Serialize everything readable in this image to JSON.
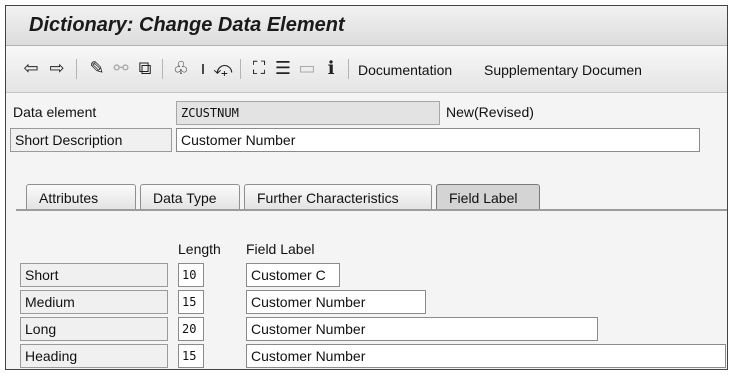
{
  "window": {
    "title": "Dictionary: Change Data Element"
  },
  "toolbar": {
    "icons": [
      "back-arrow-icon",
      "forward-arrow-icon",
      "display-change-icon",
      "activate-icon",
      "check-icon",
      "hierarchy-icon",
      "where-used-icon",
      "navigate-icon",
      "object-list-icon",
      "stack-icon",
      "display-object-icon",
      "information-icon"
    ],
    "documentation_label": "Documentation",
    "supplementary_label": "Supplementary Documen"
  },
  "header": {
    "data_element_label": "Data element",
    "data_element_value": "ZCUSTNUM",
    "status": "New(Revised)",
    "short_description_label": "Short Description",
    "short_description_value": "Customer Number"
  },
  "tabs": [
    {
      "label": "Attributes"
    },
    {
      "label": "Data Type"
    },
    {
      "label": "Further Characteristics"
    },
    {
      "label": "Field Label",
      "active": true
    }
  ],
  "field_labels": {
    "col_length": "Length",
    "col_field_label": "Field Label",
    "rows": [
      {
        "name": "Short",
        "length": "10",
        "label": "Customer C"
      },
      {
        "name": "Medium",
        "length": "15",
        "label": "Customer Number"
      },
      {
        "name": "Long",
        "length": "20",
        "label": "Customer Number"
      },
      {
        "name": "Heading",
        "length": "15",
        "label": "Customer Number"
      }
    ]
  },
  "colors": {
    "title_bar": "#dcdcdc",
    "panel": "#f4f4f4",
    "active_tab": "#d4d4d4"
  }
}
